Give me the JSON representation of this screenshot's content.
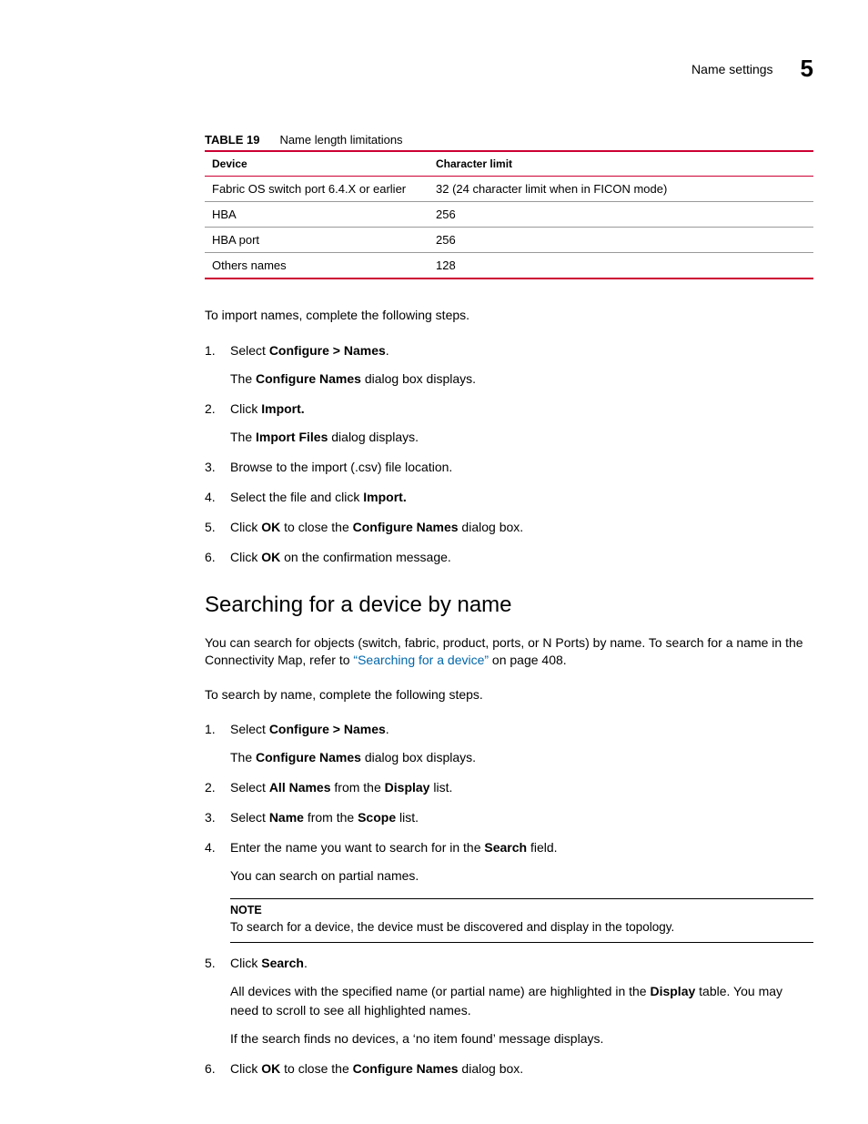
{
  "header": {
    "section_title": "Name settings",
    "chapter_number": "5"
  },
  "table": {
    "label": "TABLE 19",
    "caption": "Name length limitations",
    "columns": [
      "Device",
      "Character limit"
    ],
    "rows": [
      [
        "Fabric OS switch port 6.4.X or earlier",
        "32 (24 character limit when in FICON mode)"
      ],
      [
        "HBA",
        "256"
      ],
      [
        "HBA port",
        "256"
      ],
      [
        "Others names",
        "128"
      ]
    ]
  },
  "import_intro": "To import names, complete the following steps.",
  "import_steps": {
    "s1a": "Select ",
    "s1b": "Configure > Names",
    "s1c": ".",
    "s1sub_a": "The ",
    "s1sub_b": "Configure Names",
    "s1sub_c": " dialog box displays.",
    "s2a": "Click ",
    "s2b": "Import.",
    "s2sub_a": "The ",
    "s2sub_b": "Import Files",
    "s2sub_c": " dialog displays.",
    "s3": "Browse to the import (.csv) file location.",
    "s4a": "Select the file and click ",
    "s4b": "Import.",
    "s5a": "Click ",
    "s5b": "OK",
    "s5c": " to close the ",
    "s5d": "Configure Names",
    "s5e": " dialog box.",
    "s6a": "Click ",
    "s6b": "OK",
    "s6c": " on the confirmation message."
  },
  "search_heading": "Searching for a device by name",
  "search_para": {
    "a": "You can search for objects (switch, fabric, product, ports, or N Ports) by name. To search for a name in the Connectivity Map, refer to ",
    "link": "“Searching for a device”",
    "b": " on page 408."
  },
  "search_intro": "To search by name, complete the following steps.",
  "search_steps": {
    "s1a": "Select ",
    "s1b": "Configure > Names",
    "s1c": ".",
    "s1sub_a": "The ",
    "s1sub_b": "Configure Names",
    "s1sub_c": " dialog box displays.",
    "s2a": "Select ",
    "s2b": "All Names",
    "s2c": " from the ",
    "s2d": "Display",
    "s2e": " list.",
    "s3a": "Select ",
    "s3b": "Name",
    "s3c": " from the ",
    "s3d": "Scope",
    "s3e": " list.",
    "s4a": "Enter the name you want to search for in the ",
    "s4b": "Search",
    "s4c": " field.",
    "s4sub": "You can search on partial names.",
    "note_label": "NOTE",
    "note_body": "To search for a device, the device must be discovered and display in the topology.",
    "s5a": "Click ",
    "s5b": "Search",
    "s5c": ".",
    "s5sub1a": "All devices with the specified name (or partial name) are highlighted in the ",
    "s5sub1b": "Display",
    "s5sub1c": " table. You may need to scroll to see all highlighted names.",
    "s5sub2": "If the search finds no devices, a ‘no item found’ message displays.",
    "s6a": "Click ",
    "s6b": "OK",
    "s6c": " to close the ",
    "s6d": "Configure Names",
    "s6e": " dialog box."
  }
}
